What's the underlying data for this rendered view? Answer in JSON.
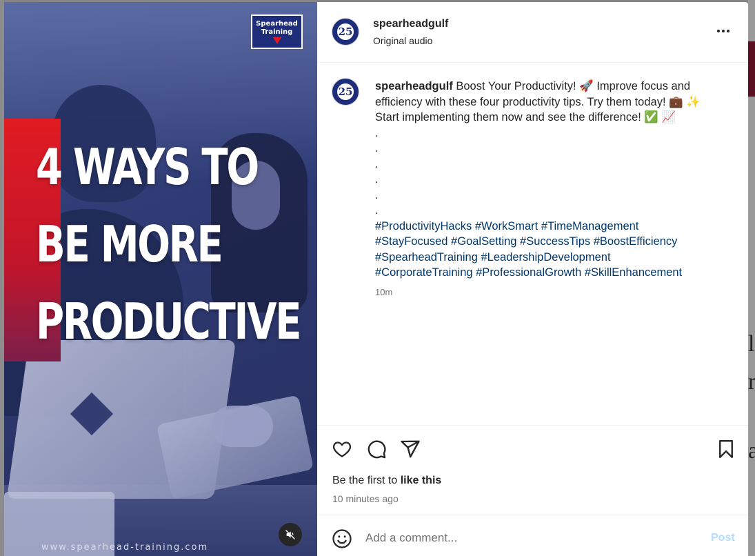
{
  "media": {
    "title_lines": [
      "4 WAYS TO",
      "BE MORE",
      "PRODUCTIVE"
    ],
    "logo_line1": "Spearhead",
    "logo_line2": "Training",
    "website": "www.spearhead-training.com"
  },
  "header": {
    "username": "spearheadgulf",
    "audio": "Original audio",
    "avatar_text": "25"
  },
  "caption": {
    "username": "spearheadgulf",
    "text": "Boost Your Productivity! 🚀 Improve focus and efficiency with these four productivity tips. Try them today! 💼 ✨ Start implementing them now and see the difference! ✅ 📈",
    "dots": [
      ".",
      ".",
      ".",
      ".",
      ".",
      "."
    ],
    "hashtag_lines": [
      "#ProductivityHacks #WorkSmart #TimeManagement",
      "#StayFocused #GoalSetting #SuccessTips #BoostEfficiency",
      "#SpearheadTraining #LeadershipDevelopment",
      "#CorporateTraining #ProfessionalGrowth #SkillEnhancement"
    ],
    "time": "10m"
  },
  "actions": {
    "likes_prefix": "Be the first to ",
    "likes_link": "like this",
    "posted": "10 minutes ago"
  },
  "comment_bar": {
    "placeholder": "Add a comment...",
    "post_label": "Post"
  },
  "icons": [
    "heart-icon",
    "comment-icon",
    "share-icon",
    "bookmark-icon",
    "emoji-icon",
    "more-icon",
    "mute-icon"
  ]
}
